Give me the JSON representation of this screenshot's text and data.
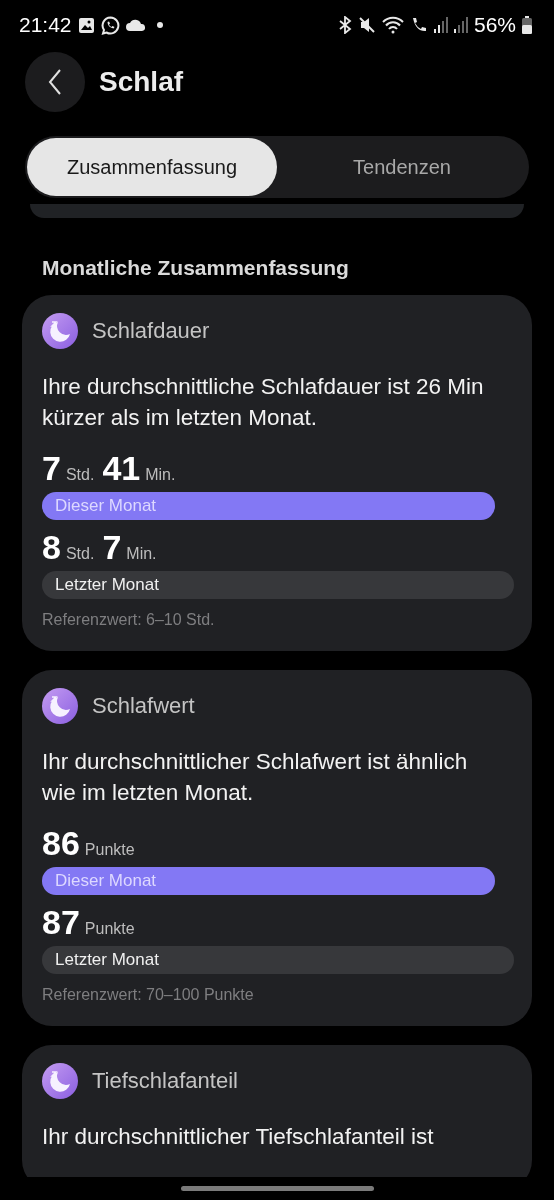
{
  "status_bar": {
    "time": "21:42",
    "battery": "56%"
  },
  "header": {
    "title": "Schlaf"
  },
  "tabs": [
    {
      "label": "Zusammenfassung",
      "selected": true
    },
    {
      "label": "Tendenzen",
      "selected": false
    }
  ],
  "section_title": "Monatliche Zusammenfassung",
  "cards": [
    {
      "title": "Schlafdauer",
      "summary": "Ihre durchschnittliche Schlafdauer ist 26 Min kürzer als im letzten Monat.",
      "entries": [
        {
          "parts": [
            {
              "kind": "number",
              "text": "7"
            },
            {
              "kind": "unit",
              "text": "Std."
            },
            {
              "kind": "number",
              "text": "41"
            },
            {
              "kind": "unit",
              "text": "Min."
            }
          ],
          "bar": {
            "kind": "current",
            "label": "Dieser Monat"
          }
        },
        {
          "parts": [
            {
              "kind": "number",
              "text": "8"
            },
            {
              "kind": "unit",
              "text": "Std."
            },
            {
              "kind": "number",
              "text": "7"
            },
            {
              "kind": "unit",
              "text": "Min."
            }
          ],
          "bar": {
            "kind": "previous",
            "label": "Letzter Monat"
          }
        }
      ],
      "reference": "Referenzwert: 6–10 Std."
    },
    {
      "title": "Schlafwert",
      "summary": "Ihr durchschnittlicher Schlafwert ist ähnlich wie im letzten Monat.",
      "entries": [
        {
          "parts": [
            {
              "kind": "number",
              "text": "86"
            },
            {
              "kind": "unit",
              "text": "Punkte"
            }
          ],
          "bar": {
            "kind": "current",
            "label": "Dieser Monat"
          }
        },
        {
          "parts": [
            {
              "kind": "number",
              "text": "87"
            },
            {
              "kind": "unit",
              "text": "Punkte"
            }
          ],
          "bar": {
            "kind": "previous",
            "label": "Letzter Monat"
          }
        }
      ],
      "reference": "Referenzwert: 70–100 Punkte"
    },
    {
      "title": "Tiefschlafanteil",
      "summary": "Ihr durchschnittlicher Tiefschlafanteil ist"
    }
  ]
}
